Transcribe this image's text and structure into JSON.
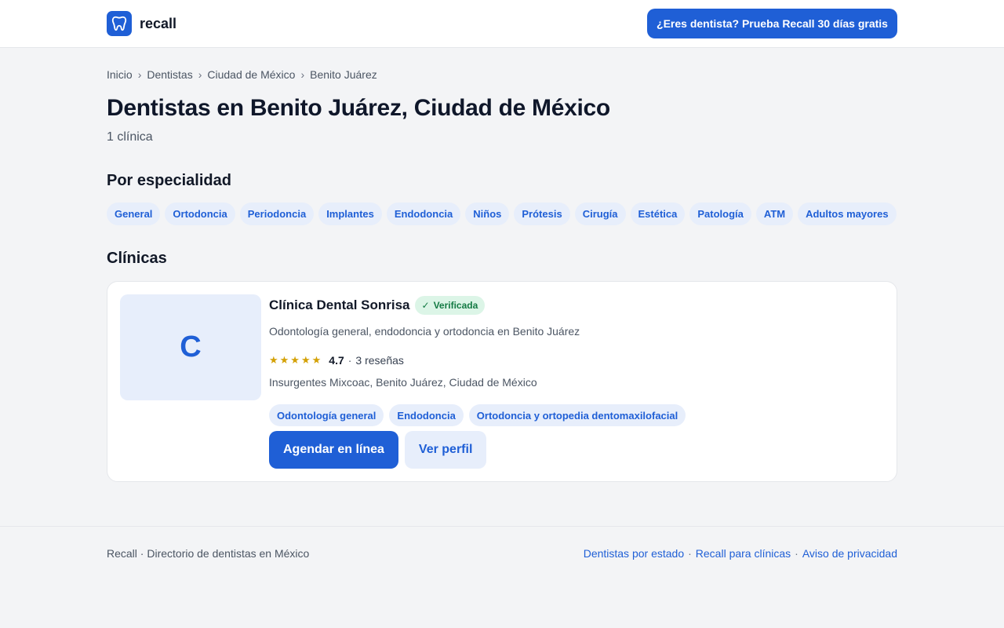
{
  "header": {
    "logo_text": "recall",
    "logo_icon": "tooth-icon",
    "cta_label": "¿Eres dentista? Prueba Recall 30 días gratis"
  },
  "breadcrumb": [
    "Inicio",
    "Dentistas",
    "Ciudad de México",
    "Benito Juárez"
  ],
  "page": {
    "title": "Dentistas en Benito Juárez, Ciudad de México",
    "count": "1 clínica"
  },
  "specialties": {
    "title": "Por especialidad",
    "items": [
      "General",
      "Ortodoncia",
      "Periodoncia",
      "Implantes",
      "Endodoncia",
      "Niños",
      "Prótesis",
      "Cirugía",
      "Estética",
      "Patología",
      "ATM",
      "Adultos mayores"
    ]
  },
  "clinics": {
    "title": "Clínicas",
    "items": [
      {
        "initial": "C",
        "name": "Clínica Dental Sonrisa",
        "verified_label": "Verificada",
        "description": "Odontología general, endodoncia y ortodoncia en Benito Juárez",
        "stars": "★★★★★",
        "rating": "4.7",
        "reviews": "3 reseñas",
        "address": "Insurgentes Mixcoac, Benito Juárez, Ciudad de México",
        "tags": [
          "Odontología general",
          "Endodoncia",
          "Ortodoncia y ortopedia dentomaxilofacial"
        ],
        "book_label": "Agendar en línea",
        "profile_label": "Ver perfil"
      }
    ]
  },
  "footer": {
    "left_text": "Recall · Directorio de dentistas en México",
    "links": [
      "Dentistas por estado",
      "Recall para clínicas",
      "Aviso de privacidad"
    ]
  },
  "colors": {
    "brand": "#1f5fd6",
    "chip_bg": "#e7eefb",
    "verified_bg": "#dcf5e7",
    "verified_text": "#137a43",
    "star": "#d4a106"
  }
}
